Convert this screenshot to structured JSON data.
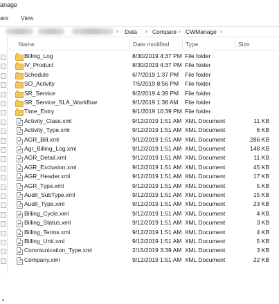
{
  "window": {
    "title": "anage"
  },
  "ribbon": {
    "tab_share": "are",
    "tab_view": "View"
  },
  "breadcrumb": [
    "Data",
    "Compare",
    "CWManage"
  ],
  "columns": {
    "name": "Name",
    "date_modified": "Date modified",
    "type": "Type",
    "size": "Size"
  },
  "rows": [
    {
      "kind": "folder",
      "name": "Billing_Log",
      "date": "8/30/2019 4:37 PM",
      "type": "File folder",
      "size": ""
    },
    {
      "kind": "folder",
      "name": "IV_Product",
      "date": "8/30/2019 4:37 PM",
      "type": "File folder",
      "size": ""
    },
    {
      "kind": "folder",
      "name": "Schedule",
      "date": "6/7/2019 1:37 PM",
      "type": "File folder",
      "size": ""
    },
    {
      "kind": "folder",
      "name": "SO_Activity",
      "date": "7/5/2019 8:56 PM",
      "type": "File folder",
      "size": ""
    },
    {
      "kind": "folder",
      "name": "SR_Service",
      "date": "9/2/2019 4:39 PM",
      "type": "File folder",
      "size": ""
    },
    {
      "kind": "folder",
      "name": "SR_Service_SLA_Workflow",
      "date": "9/1/2019 1:38 AM",
      "type": "File folder",
      "size": ""
    },
    {
      "kind": "folder",
      "name": "Time_Entry",
      "date": "9/1/2019 10:39 PM",
      "type": "File folder",
      "size": ""
    },
    {
      "kind": "file",
      "name": "Activity_Class.xml",
      "date": "9/12/2019 1:51 AM",
      "type": "XML Document",
      "size": "11 KB"
    },
    {
      "kind": "file",
      "name": "Activity_Type.xml",
      "date": "9/12/2019 1:51 AM",
      "type": "XML Document",
      "size": "6 KB"
    },
    {
      "kind": "file",
      "name": "AGR_Bill.xml",
      "date": "9/12/2019 1:51 AM",
      "type": "XML Document",
      "size": "286 KB"
    },
    {
      "kind": "file",
      "name": "Agr_Billing_Log.xml",
      "date": "9/12/2019 1:51 AM",
      "type": "XML Document",
      "size": "148 KB"
    },
    {
      "kind": "file",
      "name": "AGR_Detail.xml",
      "date": "9/12/2019 1:51 AM",
      "type": "XML Document",
      "size": "11 KB"
    },
    {
      "kind": "file",
      "name": "AGR_Exclusion.xml",
      "date": "9/12/2019 1:51 AM",
      "type": "XML Document",
      "size": "45 KB"
    },
    {
      "kind": "file",
      "name": "AGR_Header.xml",
      "date": "9/12/2019 1:51 AM",
      "type": "XML Document",
      "size": "17 KB"
    },
    {
      "kind": "file",
      "name": "AGR_Type.xml",
      "date": "9/12/2019 1:51 AM",
      "type": "XML Document",
      "size": "5 KB"
    },
    {
      "kind": "file",
      "name": "Audit_SubType.xml",
      "date": "9/12/2019 1:51 AM",
      "type": "XML Document",
      "size": "15 KB"
    },
    {
      "kind": "file",
      "name": "Audit_Type.xml",
      "date": "9/12/2019 1:51 AM",
      "type": "XML Document",
      "size": "23 KB"
    },
    {
      "kind": "file",
      "name": "Billing_Cycle.xml",
      "date": "9/12/2019 1:51 AM",
      "type": "XML Document",
      "size": "4 KB"
    },
    {
      "kind": "file",
      "name": "Billing_Status.xml",
      "date": "9/12/2019 1:51 AM",
      "type": "XML Document",
      "size": "3 KB"
    },
    {
      "kind": "file",
      "name": "Billing_Terms.xml",
      "date": "9/12/2019 1:51 AM",
      "type": "XML Document",
      "size": "4 KB"
    },
    {
      "kind": "file",
      "name": "Billing_Unit.xml",
      "date": "9/12/2019 1:51 AM",
      "type": "XML Document",
      "size": "5 KB"
    },
    {
      "kind": "file",
      "name": "Communication_Type.xml",
      "date": "2/15/2019 3:39 AM",
      "type": "XML Document",
      "size": "3 KB"
    },
    {
      "kind": "file",
      "name": "Company.xml",
      "date": "9/12/2019 1:51 AM",
      "type": "XML Document",
      "size": "22 KB"
    }
  ]
}
